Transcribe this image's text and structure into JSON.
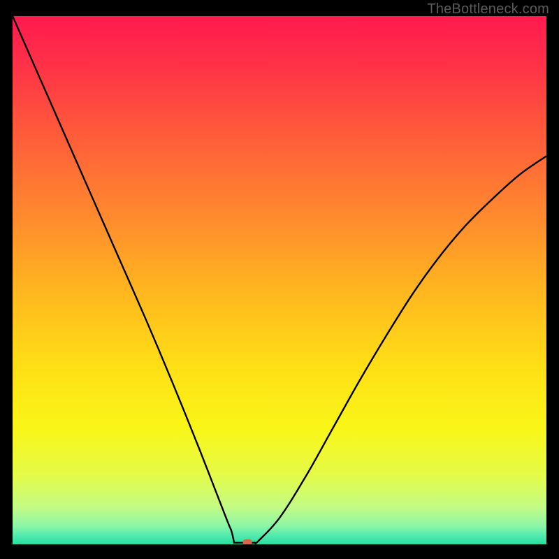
{
  "watermark": "TheBottleneck.com",
  "chart_data": {
    "type": "line",
    "title": "",
    "xlabel": "",
    "ylabel": "",
    "xlim": [
      0,
      100
    ],
    "ylim": [
      0,
      100
    ],
    "grid": false,
    "series": [
      {
        "name": "bottleneck-curve",
        "x": [
          0,
          5,
          10,
          15,
          20,
          25,
          30,
          35,
          40,
          41,
          42,
          43,
          44,
          45,
          46,
          50,
          55,
          60,
          65,
          70,
          75,
          80,
          85,
          90,
          95,
          100
        ],
        "values": [
          100,
          88.5,
          77,
          65.5,
          54,
          42.5,
          30.5,
          18,
          5,
          2.5,
          0.8,
          0.3,
          0.3,
          0.3,
          0.6,
          5,
          13,
          22,
          31,
          39.5,
          47.5,
          54.5,
          60.5,
          65.5,
          70,
          73.5
        ]
      }
    ],
    "marker": {
      "x": 44,
      "y": 0.3,
      "color": "#d36a4f"
    },
    "flat_segment": {
      "x_start": 41.5,
      "x_end": 45.5,
      "y": 0.3
    },
    "gradient_stops": [
      {
        "pos": 0.0,
        "color": "#ff1a4e"
      },
      {
        "pos": 0.1,
        "color": "#ff3447"
      },
      {
        "pos": 0.22,
        "color": "#ff5a3a"
      },
      {
        "pos": 0.38,
        "color": "#ff8a2e"
      },
      {
        "pos": 0.52,
        "color": "#ffb61f"
      },
      {
        "pos": 0.66,
        "color": "#ffde16"
      },
      {
        "pos": 0.78,
        "color": "#f9f617"
      },
      {
        "pos": 0.87,
        "color": "#e4fb49"
      },
      {
        "pos": 0.93,
        "color": "#c2fb85"
      },
      {
        "pos": 0.965,
        "color": "#8df6a6"
      },
      {
        "pos": 0.985,
        "color": "#4de9ad"
      },
      {
        "pos": 1.0,
        "color": "#27dca0"
      }
    ]
  }
}
